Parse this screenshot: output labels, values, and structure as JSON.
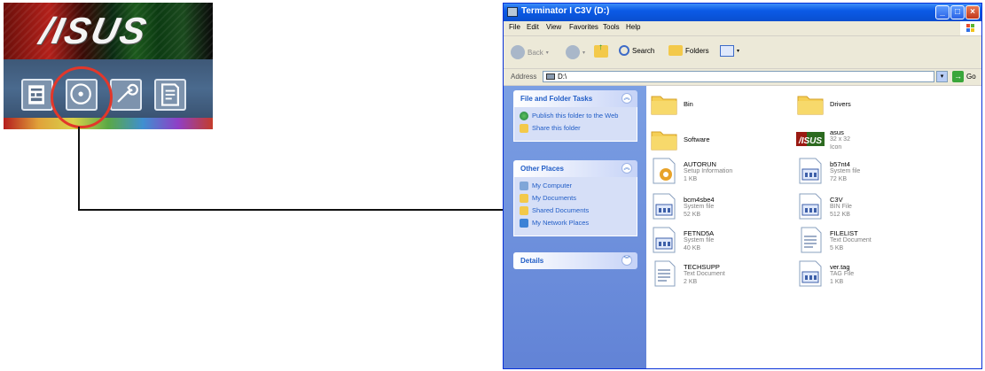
{
  "asus_panel": {
    "logo_text": "/ISUS",
    "icons": [
      "wizard-icon",
      "disc-icon",
      "wrench-icon",
      "document-icon"
    ]
  },
  "window": {
    "title": "Terminator I C3V (D:)",
    "buttons": [
      "_",
      "□",
      "×"
    ],
    "menu": [
      "File",
      "Edit",
      "View",
      "Favorites",
      "Tools",
      "Help"
    ],
    "toolbar": {
      "back": "Back",
      "search": "Search",
      "folders": "Folders"
    },
    "address": {
      "label": "Address",
      "value": "D:\\",
      "go": "Go"
    }
  },
  "tasks": {
    "file_folder": {
      "title": "File and Folder Tasks",
      "links": [
        "Publish this folder to the Web",
        "Share this folder"
      ]
    },
    "other_places": {
      "title": "Other Places",
      "links": [
        "My Computer",
        "My Documents",
        "Shared Documents",
        "My Network Places"
      ]
    },
    "details": {
      "title": "Details"
    }
  },
  "files": [
    {
      "name": "Bin",
      "meta": "",
      "icon": "folder-icon"
    },
    {
      "name": "Drivers",
      "meta": "",
      "icon": "folder-icon"
    },
    {
      "name": "Software",
      "meta": "",
      "icon": "folder-icon"
    },
    {
      "name": "asus",
      "meta": "32 x 32\nIcon",
      "icon": "asus-icon"
    },
    {
      "name": "AUTORUN",
      "meta": "Setup Information\n1 KB",
      "icon": "setup-info-icon"
    },
    {
      "name": "b57nt4",
      "meta": "System file\n72 KB",
      "icon": "system-file-icon"
    },
    {
      "name": "bcm4sbe4",
      "meta": "System file\n52 KB",
      "icon": "system-file-icon"
    },
    {
      "name": "C3V",
      "meta": "BIN File\n512 KB",
      "icon": "system-file-icon"
    },
    {
      "name": "FETND5A",
      "meta": "System file\n40 KB",
      "icon": "system-file-icon"
    },
    {
      "name": "FILELIST",
      "meta": "Text Document\n5 KB",
      "icon": "text-document-icon"
    },
    {
      "name": "TECHSUPP",
      "meta": "Text Document\n2 KB",
      "icon": "text-document-icon"
    },
    {
      "name": "ver.tag",
      "meta": "TAG File\n1 KB",
      "icon": "system-file-icon"
    }
  ]
}
